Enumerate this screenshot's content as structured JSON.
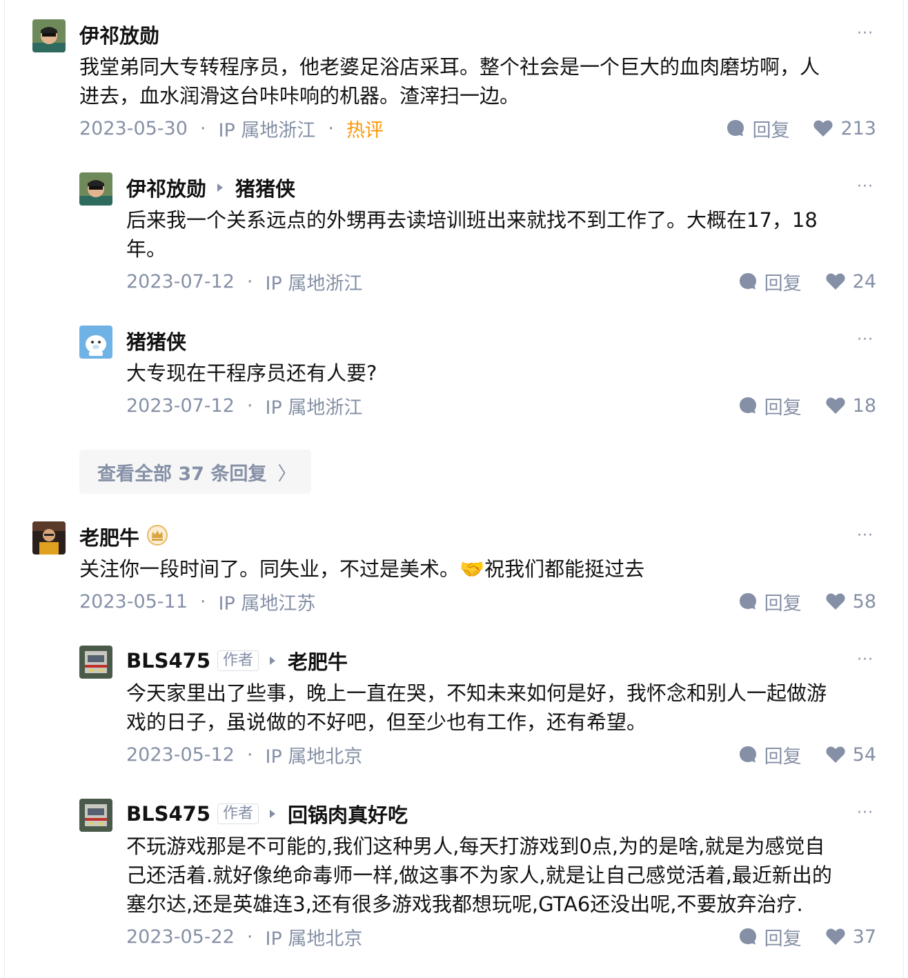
{
  "labels": {
    "reply": "回复",
    "author_badge": "作者",
    "more": "···",
    "view_all": "查看全部 37 条回复",
    "view_all_chevron": "〉"
  },
  "comments": [
    {
      "user": "伊祁放勋",
      "content_lines": [
        "我堂弟同大专转程序员，他老婆足浴店采耳。整个社会是一个巨大的血肉磨坊啊，人",
        "进去，血水润滑这台咔咔响的机器。渣滓扫一边。"
      ],
      "date": "2023-05-30",
      "ip": "IP 属地浙江",
      "tag": "热评",
      "likes": "213"
    },
    {
      "user": "伊祁放勋",
      "reply_to": "猪猪侠",
      "content_lines": [
        "后来我一个关系远点的外甥再去读培训班出来就找不到工作了。大概在17，18",
        "年。"
      ],
      "date": "2023-07-12",
      "ip": "IP 属地浙江",
      "likes": "24"
    },
    {
      "user": "猪猪侠",
      "content_lines": [
        "大专现在干程序员还有人要?"
      ],
      "date": "2023-07-12",
      "ip": "IP 属地浙江",
      "likes": "18"
    },
    {
      "user": "老肥牛",
      "content_lines": [
        "关注你一段时间了。同失业，不过是美术。🤝祝我们都能挺过去"
      ],
      "date": "2023-05-11",
      "ip": "IP 属地江苏",
      "likes": "58"
    },
    {
      "user": "BLS475",
      "reply_to": "老肥牛",
      "content_lines": [
        "今天家里出了些事，晚上一直在哭，不知未来如何是好，我怀念和别人一起做游",
        "戏的日子，虽说做的不好吧，但至少也有工作，还有希望。"
      ],
      "date": "2023-05-12",
      "ip": "IP 属地北京",
      "likes": "54"
    },
    {
      "user": "BLS475",
      "reply_to": "回锅肉真好吃",
      "content_lines": [
        "不玩游戏那是不可能的,我们这种男人,每天打游戏到0点,为的是啥,就是为感觉自",
        "己还活着.就好像绝命毒师一样,做这事不为家人,就是让自己感觉活着,最近新出的",
        "塞尔达,还是英雄连3,还有很多游戏我都想玩呢,GTA6还没出呢,不要放弃治疗."
      ],
      "date": "2023-05-22",
      "ip": "IP 属地北京",
      "likes": "37"
    }
  ]
}
